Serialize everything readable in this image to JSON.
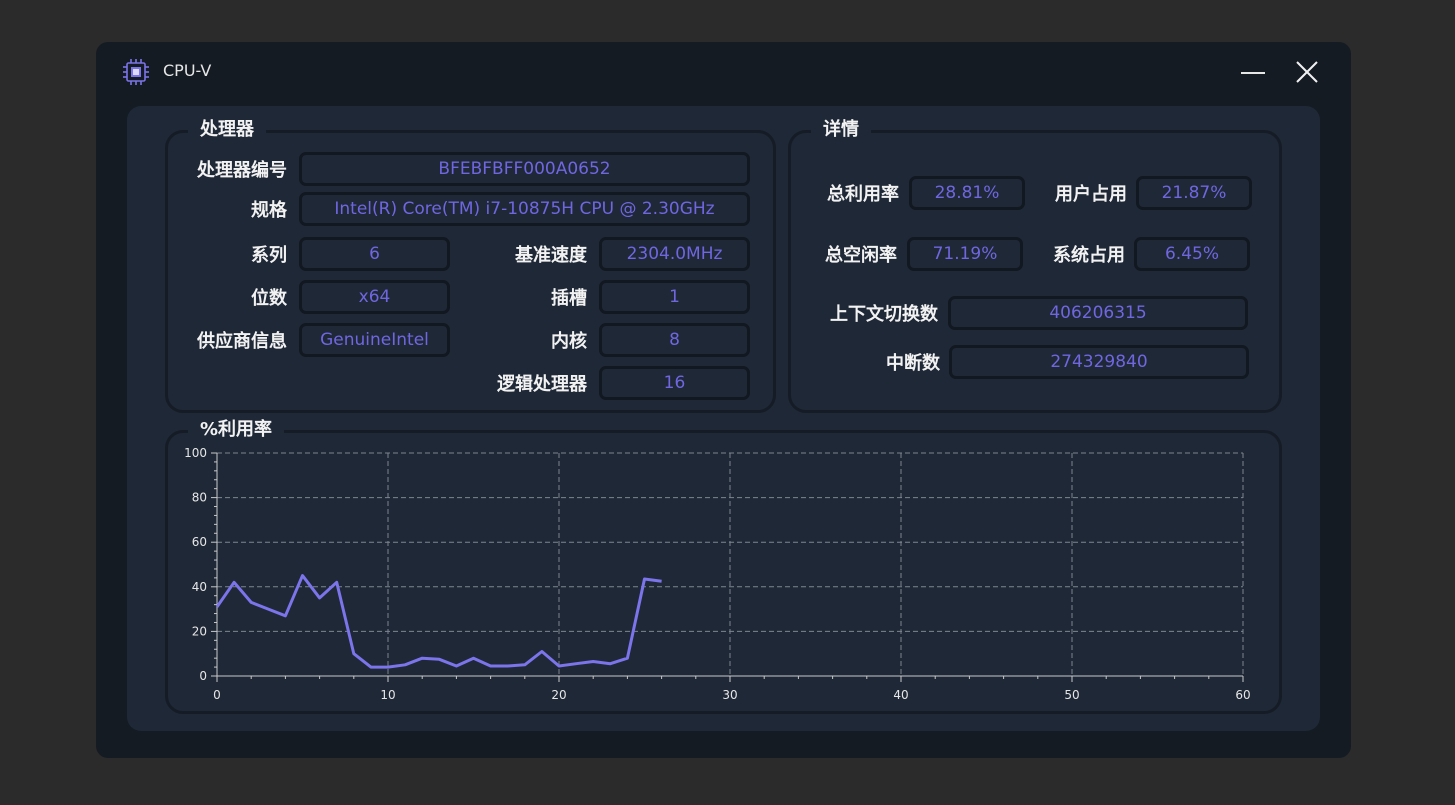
{
  "app": {
    "title": "CPU-V"
  },
  "processor": {
    "title": "处理器",
    "fields": {
      "processor_id": {
        "label": "处理器编号",
        "value": "BFEBFBFF000A0652"
      },
      "spec": {
        "label": "规格",
        "value": "Intel(R) Core(TM) i7-10875H CPU @ 2.30GHz"
      },
      "family": {
        "label": "系列",
        "value": "6"
      },
      "base_speed": {
        "label": "基准速度",
        "value": "2304.0MHz"
      },
      "bits": {
        "label": "位数",
        "value": "x64"
      },
      "socket": {
        "label": "插槽",
        "value": "1"
      },
      "vendor": {
        "label": "供应商信息",
        "value": "GenuineIntel"
      },
      "cores": {
        "label": "内核",
        "value": "8"
      },
      "logical": {
        "label": "逻辑处理器",
        "value": "16"
      }
    }
  },
  "details": {
    "title": "详情",
    "fields": {
      "total_usage": {
        "label": "总利用率",
        "value": "28.81%"
      },
      "user_usage": {
        "label": "用户占用",
        "value": "21.87%"
      },
      "total_idle": {
        "label": "总空闲率",
        "value": "71.19%"
      },
      "system_usage": {
        "label": "系统占用",
        "value": "6.45%"
      },
      "context_switches": {
        "label": "上下文切换数",
        "value": "406206315"
      },
      "interrupts": {
        "label": "中断数",
        "value": "274329840"
      }
    }
  },
  "chart_title": "%利用率",
  "chart_data": {
    "type": "line",
    "title": "%利用率",
    "xlabel": "",
    "ylabel": "",
    "xlim": [
      0,
      60
    ],
    "ylim": [
      0,
      100
    ],
    "x_ticks": [
      0,
      10,
      20,
      30,
      40,
      50,
      60
    ],
    "y_ticks": [
      0,
      20,
      40,
      60,
      80,
      100
    ],
    "grid": true,
    "series": [
      {
        "color": "#7b74ea",
        "x": [
          0,
          1,
          2,
          3,
          4,
          5,
          6,
          7,
          8,
          9,
          10,
          11,
          12,
          13,
          14,
          15,
          16,
          17,
          18,
          19,
          20,
          21,
          22,
          23,
          24,
          25,
          26
        ],
        "values": [
          31,
          42,
          33,
          30,
          27,
          45,
          35,
          42,
          10,
          4,
          4,
          5,
          8,
          7.5,
          4.5,
          8,
          4.5,
          4.5,
          5,
          11,
          4.5,
          5.5,
          6.5,
          5.5,
          8,
          43.5,
          42.5
        ]
      }
    ]
  },
  "colors": {
    "window_bg": "#141b23",
    "panel_bg": "#1f2837",
    "value_text": "#6f66e0",
    "accent": "#7b74ea"
  },
  "icons": {
    "app": "cpu-chip-icon",
    "minimize": "minimize-icon",
    "close": "close-icon"
  }
}
